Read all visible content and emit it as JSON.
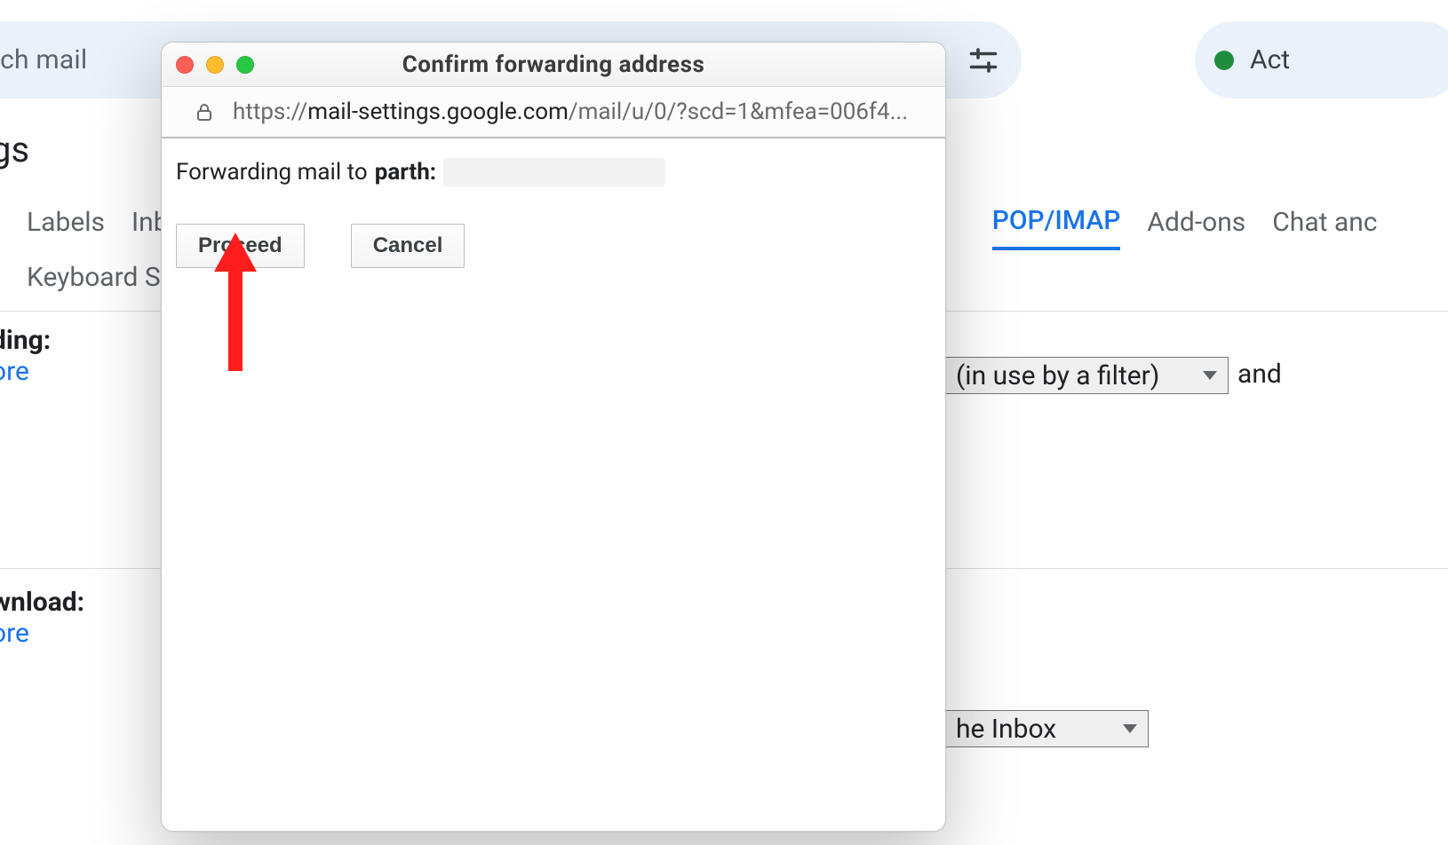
{
  "background": {
    "search_placeholder": "rch mail",
    "active_label": "Act",
    "page_title": "gs",
    "tabs": {
      "labels": "Labels",
      "inbox": "Inbo",
      "keyboard": "Keyboard Sho",
      "popimap": "POP/IMAP",
      "addons": "Add-ons",
      "chat": "Chat anc"
    },
    "section_forwarding": {
      "hdr": "ding:",
      "link": "ore"
    },
    "filter_select": "(in use by a filter)",
    "and_label": "and",
    "section_download": {
      "hdr": "wnload:",
      "link": "ore"
    },
    "inbox_select": "he Inbox"
  },
  "window": {
    "title": "Confirm forwarding address",
    "url": {
      "proto": "https://",
      "host": "mail-settings.google.com",
      "path": "/mail/u/0/?scd=1&mfea=006f4..."
    },
    "forward_prefix": "Forwarding mail to",
    "forward_email_visible": "parth:",
    "proceed": "Proceed",
    "cancel": "Cancel"
  }
}
